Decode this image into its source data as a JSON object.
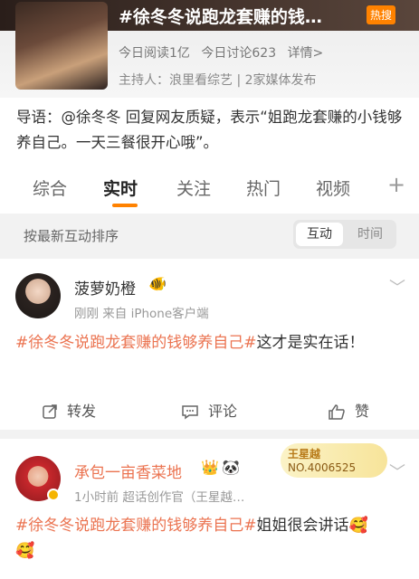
{
  "topic": {
    "title": "#徐冬冬说跑龙套赚的钱…",
    "hot_badge": "热搜",
    "reads": "今日阅读1亿",
    "discuss": "今日讨论623",
    "details": "详情>",
    "host": "主持人：浪里看综艺 | 2家媒体发布"
  },
  "intro": "导语：@徐冬冬 回复网友质疑，表示“姐跑龙套赚的小钱够养自己。一天三餐很开心哦”。",
  "tabs": [
    "综合",
    "实时",
    "关注",
    "热门",
    "视频"
  ],
  "tab_plus": "+",
  "sort": {
    "label": "按最新互动排序",
    "on": "互动",
    "off": "时间"
  },
  "posts": [
    {
      "name": "菠萝奶橙",
      "meta": "刚刚  来自 iPhone客户端",
      "tag": "#徐冬冬说跑龙套赚的钱够养自己#",
      "text": "这才是实在话！",
      "repost": "转发",
      "comment": "评论",
      "like": "赞"
    },
    {
      "name": "承包一亩香菜地",
      "meta": "1小时前  超话创作官（王星越…",
      "tag": "#徐冬冬说跑龙套赚的钱够养自己#",
      "text": "姐姐很会讲话🥰",
      "text2": "🥰",
      "rank_name": "王星越",
      "rank_no": "NO.4006525"
    }
  ],
  "colors": {
    "accent": "#ff8200",
    "topic_link": "#eb7350"
  }
}
